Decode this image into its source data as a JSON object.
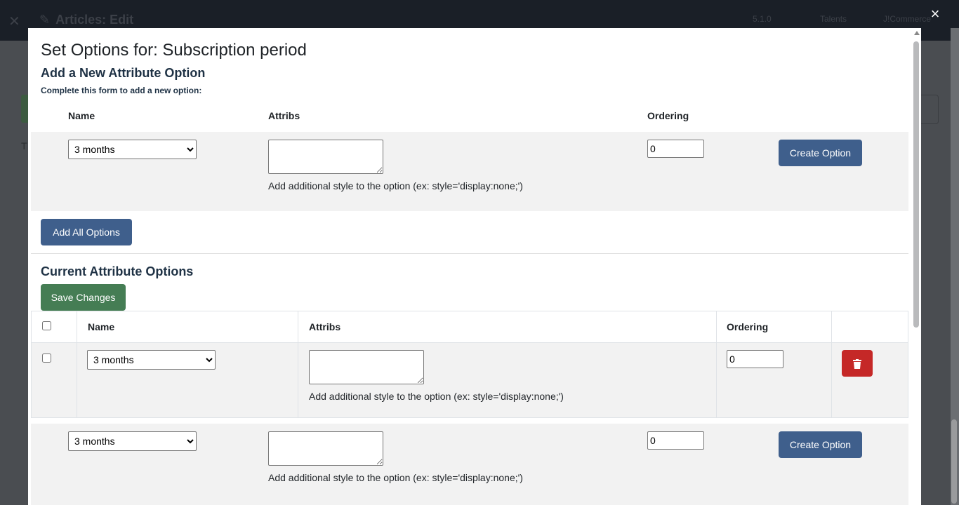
{
  "background": {
    "title": "Articles: Edit",
    "header_right": [
      "5.1.0",
      "Talents",
      "J!Commerce"
    ]
  },
  "modal": {
    "close_label": "×",
    "title": "Set Options for: Subscription period",
    "new_section": {
      "heading": "Add a New Attribute Option",
      "subtext": "Complete this form to add a new option:",
      "columns": [
        "Name",
        "Attribs",
        "Ordering"
      ],
      "row": {
        "name_selected": "3 months",
        "attribs_hint": "Add additional style to the option (ex: style='display:none;')",
        "ordering": "0",
        "create_label": "Create Option"
      },
      "add_all_label": "Add All Options"
    },
    "current_section": {
      "heading": "Current Attribute Options",
      "save_label": "Save Changes",
      "columns": [
        "Name",
        "Attribs",
        "Ordering"
      ],
      "rows": [
        {
          "name_selected": "3 months",
          "attribs_hint": "Add additional style to the option (ex: style='display:none;')",
          "ordering": "0"
        }
      ]
    },
    "bottom_row": {
      "name_selected": "3 months",
      "attribs_hint": "Add additional style to the option (ex: style='display:none;')",
      "ordering": "0",
      "create_label": "Create Option"
    }
  },
  "colors": {
    "primary": "#3f5f8c",
    "success": "#457d54",
    "danger": "#c52827",
    "heading": "#1f3245"
  },
  "icons": [
    "close-icon",
    "trash-icon",
    "joomla-logo-icon",
    "pencil-icon"
  ]
}
